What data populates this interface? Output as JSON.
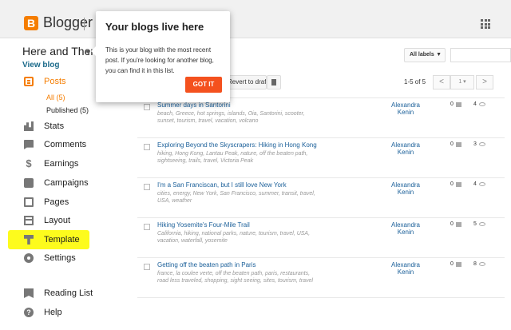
{
  "header": {
    "logo_letter": "B",
    "brand": "Blogger"
  },
  "blog": {
    "title": "Here and There",
    "view_blog": "View blog"
  },
  "sidebar": {
    "posts": "Posts",
    "sub_all": "All (5)",
    "sub_published": "Published (5)",
    "items": [
      {
        "label": "Stats",
        "icon": "stats-icon"
      },
      {
        "label": "Comments",
        "icon": "comments-icon"
      },
      {
        "label": "Earnings",
        "icon": "dollar-icon"
      },
      {
        "label": "Campaigns",
        "icon": "campaigns-icon"
      },
      {
        "label": "Pages",
        "icon": "pages-icon"
      },
      {
        "label": "Layout",
        "icon": "layout-icon"
      },
      {
        "label": "Template",
        "icon": "template-icon"
      },
      {
        "label": "Settings",
        "icon": "settings-icon"
      },
      {
        "label": "Reading List",
        "icon": "reading-list-icon"
      },
      {
        "label": "Help",
        "icon": "help-icon"
      }
    ],
    "highlight_color": "#fdfb1d"
  },
  "tooltip": {
    "title": "Your blogs live here",
    "body": "This is your blog with the most recent post. If you're looking for another blog, you can find it in this list.",
    "button": "GOT IT"
  },
  "toolbar": {
    "revert": "Revert to draft",
    "labels_filter": "All labels",
    "count": "1-5 of 5",
    "page": "1",
    "prev": "<",
    "next": ">"
  },
  "posts": [
    {
      "title": "Summer days in Santorini",
      "labels": "beach, Greece, hot springs, islands, Oia, Santorini, scooter, sunset, tourism, travel, vacation, volcano",
      "author": "Alexandra Kenin",
      "comments": "0",
      "views": "4"
    },
    {
      "title": "Exploring Beyond the Skyscrapers: Hiking in Hong Kong",
      "labels": "hiking, Hong Kong, Lantau Peak, nature, off the beaten path, sightseeing, trails, travel, Victoria Peak",
      "author": "Alexandra Kenin",
      "comments": "0",
      "views": "3"
    },
    {
      "title": "I'm a San Franciscan, but I still love New York",
      "labels": "cities, energy, New York, San Francisco, summer, transit, travel, USA, weather",
      "author": "Alexandra Kenin",
      "comments": "0",
      "views": "4"
    },
    {
      "title": "Hiking Yosemite's Four-Mile Trail",
      "labels": "California, hiking, national parks, nature, tourism, travel, USA, vacation, waterfall, yosemite",
      "author": "Alexandra Kenin",
      "comments": "0",
      "views": "5"
    },
    {
      "title": "Getting off the beaten path in Paris",
      "labels": "france, la coulee verte, off the beaten path, paris, restaurants, road less traveled, shopping, sight seeing, sites, tourism, travel",
      "author": "Alexandra Kenin",
      "comments": "0",
      "views": "8"
    }
  ],
  "colors": {
    "accent": "#f57d00",
    "link": "#1a5f99",
    "button": "#f4511e"
  }
}
